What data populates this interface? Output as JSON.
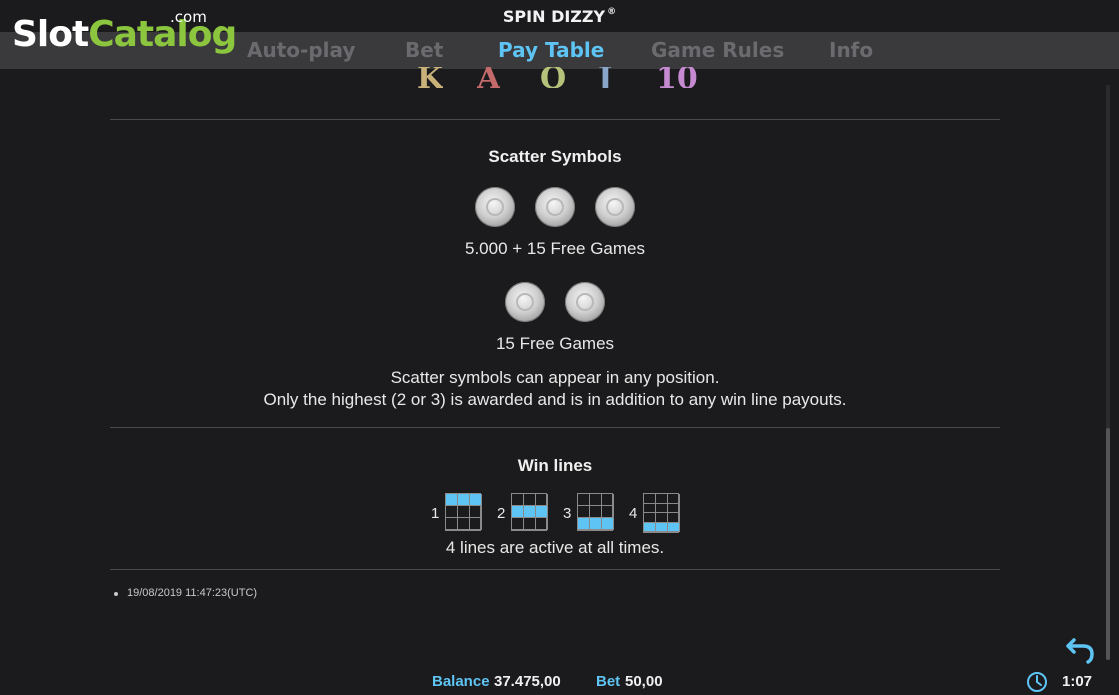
{
  "logo": {
    "slot": "Slot",
    "catalog": "Catalog",
    "com": ".com"
  },
  "header": {
    "title": "SPIN DIZZY",
    "reg_mark": "®"
  },
  "nav": {
    "tabs": [
      {
        "label": "Auto-play"
      },
      {
        "label": "Bet"
      },
      {
        "label": "Pay Table",
        "active": true
      },
      {
        "label": "Game Rules"
      },
      {
        "label": "Info"
      }
    ]
  },
  "top_symbols": [
    "K",
    "A",
    "Q",
    "J",
    "10"
  ],
  "scatter": {
    "heading": "Scatter Symbols",
    "pay_3": "5.000 + 15 Free Games",
    "pay_2": "15 Free Games",
    "note_1": "Scatter symbols can appear in any position.",
    "note_2": "Only the highest (2 or 3) is awarded and is in addition to any win line payouts."
  },
  "winlines": {
    "heading": "Win lines",
    "lines": [
      {
        "number": "1",
        "row": 0
      },
      {
        "number": "2",
        "row": 1
      },
      {
        "number": "3",
        "row": 2
      },
      {
        "number": "4",
        "row": 3
      }
    ],
    "note": "4 lines are active at all times."
  },
  "timestamp": "19/08/2019 11:47:23(UTC)",
  "footer": {
    "balance_label": "Balance",
    "balance_value": "37.475,00",
    "bet_label": "Bet",
    "bet_value": "50,00",
    "time": "1:07"
  },
  "colors": {
    "accent": "#5ec4f4",
    "logo_green": "#8cc63f",
    "background": "#1b1b1d"
  },
  "icons": {
    "back": "undo-arrow-icon",
    "clock": "clock-icon"
  }
}
